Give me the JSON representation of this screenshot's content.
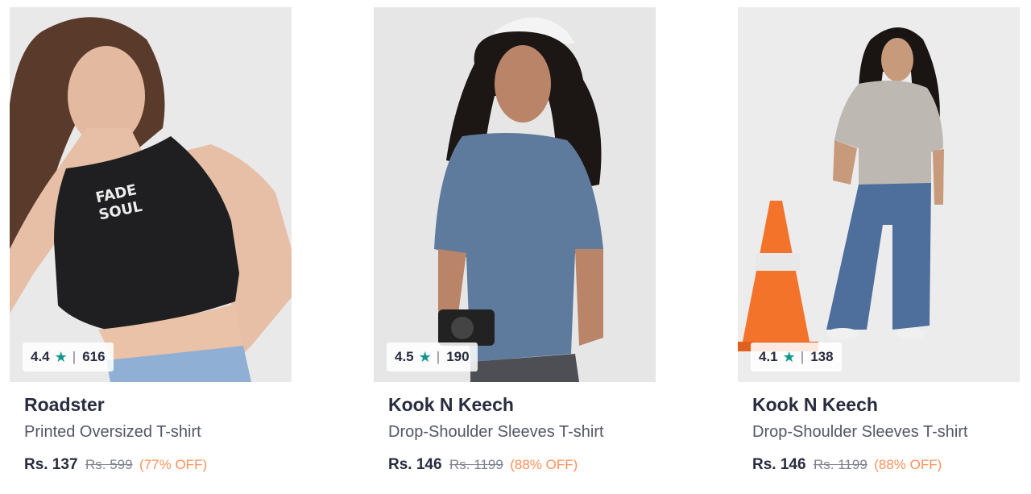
{
  "products": [
    {
      "rating": "4.4",
      "rating_count": "616",
      "star_icon": "★",
      "separator": "|",
      "brand": "Roadster",
      "name": "Printed Oversized T-shirt",
      "price": "Rs. 137",
      "mrp": "Rs. 599",
      "discount": "(77% OFF)"
    },
    {
      "rating": "4.5",
      "rating_count": "190",
      "star_icon": "★",
      "separator": "|",
      "brand": "Kook N Keech",
      "name": "Drop-Shoulder Sleeves T-shirt",
      "price": "Rs. 146",
      "mrp": "Rs. 1199",
      "discount": "(88% OFF)"
    },
    {
      "rating": "4.1",
      "rating_count": "138",
      "star_icon": "★",
      "separator": "|",
      "brand": "Kook N Keech",
      "name": "Drop-Shoulder Sleeves T-shirt",
      "price": "Rs. 146",
      "mrp": "Rs. 1199",
      "discount": "(88% OFF)"
    }
  ],
  "colors": {
    "star": "#14958f",
    "discount": "#ff905a",
    "brand_text": "#282c3f",
    "name_text": "#535766",
    "mrp_text": "#7e818c"
  }
}
